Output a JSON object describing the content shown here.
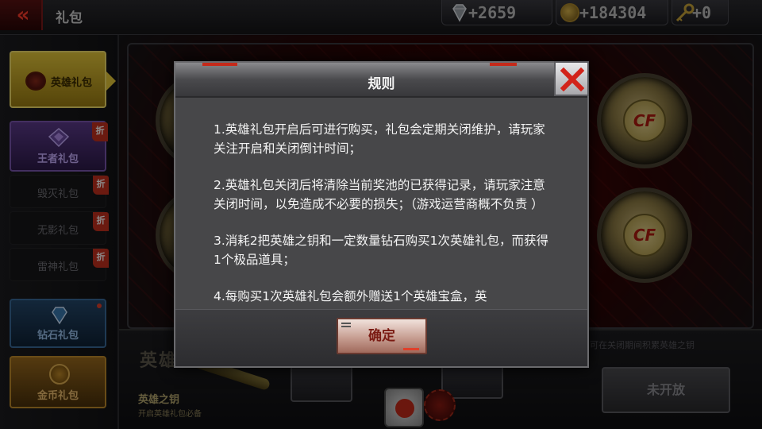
{
  "header": {
    "title": "礼包",
    "diamonds": "+2659",
    "coins": "+184304",
    "keys": "+0"
  },
  "sidebar": {
    "items": [
      {
        "label": "英雄礼包",
        "state": "active"
      },
      {
        "label": "王者礼包",
        "badge": "折"
      },
      {
        "label": "毁灭礼包",
        "badge": "折"
      },
      {
        "label": "无影礼包",
        "badge": "折"
      },
      {
        "label": "雷神礼包",
        "badge": "折"
      },
      {
        "label": "钻石礼包"
      },
      {
        "label": "金币礼包"
      }
    ]
  },
  "background": {
    "pack_heading": "英雄礼包",
    "key_name": "英雄之钥",
    "key_desc": "开启英雄礼包必备",
    "note": "英雄礼包购买需要英雄之钥，可在关闭期间积累英雄之钥",
    "coin_mark": "CF",
    "not_open_label": "未开放"
  },
  "modal": {
    "title": "规则",
    "rules": [
      "1.英雄礼包开启后可进行购买，礼包会定期关闭维护，请玩家关注开启和关闭倒计时间；",
      "2.英雄礼包关闭后将清除当前奖池的已获得记录，请玩家注意关闭时间，以免造成不必要的损失；（游戏运营商概不负责 ）",
      "3.消耗2把英雄之钥和一定数量钻石购买1次英雄礼包，而获得1个极品道具；",
      "4.每购买1次英雄礼包会额外赠送1个英雄宝盒，英"
    ],
    "confirm_label": "确定"
  },
  "colors": {
    "accent_red": "#c52a1a",
    "active_tab_gold": "#e5c83a",
    "modal_bg": "#474749"
  }
}
